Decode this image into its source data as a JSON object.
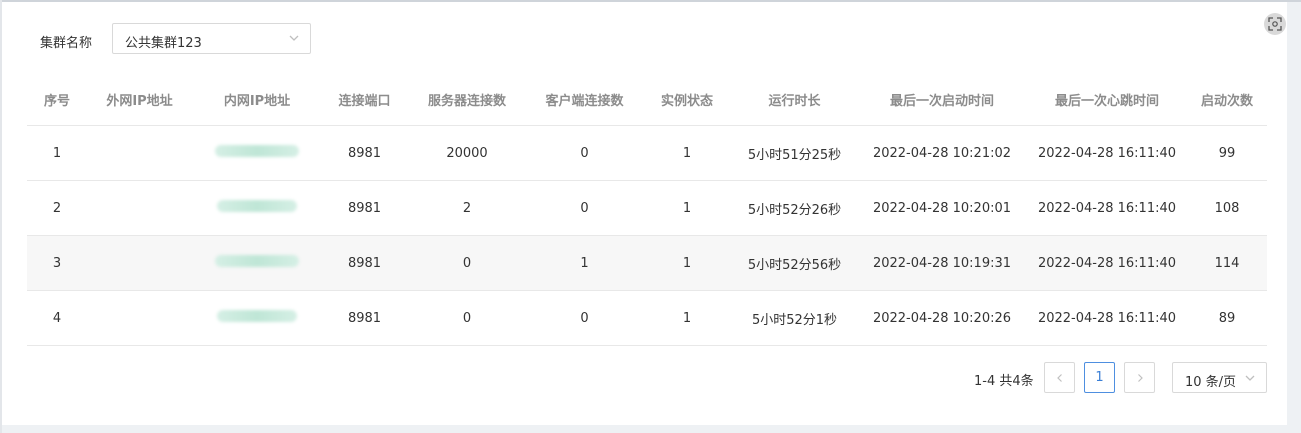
{
  "filter": {
    "label": "集群名称",
    "selected": "公共集群123"
  },
  "table": {
    "columns": [
      "序号",
      "外网IP地址",
      "内网IP地址",
      "连接端口",
      "服务器连接数",
      "客户端连接数",
      "实例状态",
      "运行时长",
      "最后一次启动时间",
      "最后一次心跳时间",
      "启动次数"
    ],
    "rows": [
      {
        "index": "1",
        "public_ip": "",
        "private_ip": "",
        "port": "8981",
        "server_conn": "20000",
        "client_conn": "0",
        "status": "1",
        "uptime": "5小时51分25秒",
        "last_start": "2022-04-28 10:21:02",
        "last_heartbeat": "2022-04-28 16:11:40",
        "start_count": "99"
      },
      {
        "index": "2",
        "public_ip": "",
        "private_ip": "",
        "port": "8981",
        "server_conn": "2",
        "client_conn": "0",
        "status": "1",
        "uptime": "5小时52分26秒",
        "last_start": "2022-04-28 10:20:01",
        "last_heartbeat": "2022-04-28 16:11:40",
        "start_count": "108"
      },
      {
        "index": "3",
        "public_ip": "",
        "private_ip": "",
        "port": "8981",
        "server_conn": "0",
        "client_conn": "1",
        "status": "1",
        "uptime": "5小时52分56秒",
        "last_start": "2022-04-28 10:19:31",
        "last_heartbeat": "2022-04-28 16:11:40",
        "start_count": "114"
      },
      {
        "index": "4",
        "public_ip": "",
        "private_ip": "",
        "port": "8981",
        "server_conn": "0",
        "client_conn": "0",
        "status": "1",
        "uptime": "5小时52分1秒",
        "last_start": "2022-04-28 10:20:26",
        "last_heartbeat": "2022-04-28 16:11:40",
        "start_count": "89"
      }
    ]
  },
  "pagination": {
    "total_text": "1-4 共4条",
    "current_page": "1",
    "page_size": "10 条/页",
    "prev_icon": "chevron-left-icon",
    "next_icon": "chevron-right-icon"
  },
  "icons": {
    "expand": "fullscreen-icon",
    "select_arrow": "chevron-down-icon"
  },
  "colors": {
    "accent": "#3a7fd6",
    "masked_ip": "#bfe6d6"
  }
}
